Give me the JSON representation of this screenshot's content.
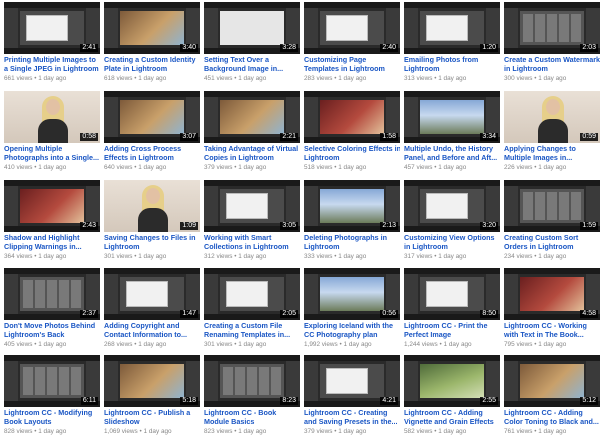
{
  "videos": [
    {
      "title1": "Printing Multiple Images to",
      "title2": "a Single JPEG in Lightroom",
      "meta": "661 views • 1 day ago",
      "duration": "2:41",
      "thumb": "dialog"
    },
    {
      "title1": "Creating a Custom Identity",
      "title2": "Plate in Lightroom",
      "meta": "618 views • 1 day ago",
      "duration": "3:40",
      "thumb": "photo"
    },
    {
      "title1": "Setting Text Over a",
      "title2": "Background Image in...",
      "meta": "451 views • 1 day ago",
      "duration": "3:28",
      "thumb": "light"
    },
    {
      "title1": "Customizing Page",
      "title2": "Templates in Lightroom",
      "meta": "283 views • 1 day ago",
      "duration": "2:40",
      "thumb": "dialog"
    },
    {
      "title1": "Emailing Photos from",
      "title2": "Lightroom",
      "meta": "313 views • 1 day ago",
      "duration": "1:20",
      "thumb": "dialog"
    },
    {
      "title1": "Create a Custom Watermark",
      "title2": "in Lightroom",
      "meta": "300 views • 1 day ago",
      "duration": "2:03",
      "thumb": "grid"
    },
    {
      "title1": "Opening Multiple",
      "title2": "Photographs into a Single...",
      "meta": "410 views • 1 day ago",
      "duration": "0:58",
      "thumb": "person"
    },
    {
      "title1": "Adding Cross Process",
      "title2": "Effects in Lightroom",
      "meta": "640 views • 1 day ago",
      "duration": "3:07",
      "thumb": "photo"
    },
    {
      "title1": "Taking Advantage of Virtual",
      "title2": "Copies in Lightroom",
      "meta": "379 views • 1 day ago",
      "duration": "2:21",
      "thumb": "photo"
    },
    {
      "title1": "Selective Coloring Effects in",
      "title2": "Lightroom",
      "meta": "518 views • 1 day ago",
      "duration": "1:58",
      "thumb": "photo red"
    },
    {
      "title1": "Multiple Undo, the History",
      "title2": "Panel, and Before and Aft...",
      "meta": "457 views • 1 day ago",
      "duration": "3:34",
      "thumb": "photo sky"
    },
    {
      "title1": "Applying Changes to",
      "title2": "Multiple Images in...",
      "meta": "226 views • 1 day ago",
      "duration": "0:59",
      "thumb": "person"
    },
    {
      "title1": "Shadow and Highlight",
      "title2": "Clipping Warnings in...",
      "meta": "364 views • 1 day ago",
      "duration": "2:43",
      "thumb": "photo red"
    },
    {
      "title1": "Saving Changes to Files in",
      "title2": "Lightroom",
      "meta": "301 views • 1 day ago",
      "duration": "1:09",
      "thumb": "person"
    },
    {
      "title1": "Working with Smart",
      "title2": "Collections in Lightroom",
      "meta": "312 views • 1 day ago",
      "duration": "3:05",
      "thumb": "dialog"
    },
    {
      "title1": "Deleting Photographs in",
      "title2": "Lightroom",
      "meta": "333 views • 1 day ago",
      "duration": "2:13",
      "thumb": "photo sky"
    },
    {
      "title1": "Customizing View Options",
      "title2": "in Lightroom",
      "meta": "317 views • 1 day ago",
      "duration": "3:20",
      "thumb": "dialog"
    },
    {
      "title1": "Creating Custom Sort",
      "title2": "Orders in Lightroom",
      "meta": "234 views • 1 day ago",
      "duration": "1:59",
      "thumb": "grid"
    },
    {
      "title1": "Don't Move Photos Behind",
      "title2": "Lightroom's Back",
      "meta": "405 views • 1 day ago",
      "duration": "2:37",
      "thumb": "grid"
    },
    {
      "title1": "Adding Copyright and",
      "title2": "Contact Information to...",
      "meta": "268 views • 1 day ago",
      "duration": "1:47",
      "thumb": "dialog"
    },
    {
      "title1": "Creating a Custom File",
      "title2": "Renaming Templates in...",
      "meta": "301 views • 1 day ago",
      "duration": "2:05",
      "thumb": "dialog"
    },
    {
      "title1": "Exploring Iceland with the",
      "title2": "CC Photography plan",
      "meta": "1,992 views • 1 day ago",
      "duration": "0:56",
      "thumb": "photo sky"
    },
    {
      "title1": "Lightroom CC - Print the",
      "title2": "Perfect Image",
      "meta": "1,244 views • 1 day ago",
      "duration": "8:50",
      "thumb": "dialog"
    },
    {
      "title1": "Lightroom CC - Working",
      "title2": "with Text in The Book...",
      "meta": "795 views • 1 day ago",
      "duration": "4:58",
      "thumb": "photo red"
    },
    {
      "title1": "Lightroom CC - Modifying",
      "title2": "Book Layouts",
      "meta": "828 views • 1 day ago",
      "duration": "6:11",
      "thumb": "grid"
    },
    {
      "title1": "Lightroom CC - Publish a",
      "title2": "Slideshow",
      "meta": "1,069 views • 1 day ago",
      "duration": "5:18",
      "thumb": "photo"
    },
    {
      "title1": "Lightroom CC - Book",
      "title2": "Module Basics",
      "meta": "823 views • 1 day ago",
      "duration": "8:23",
      "thumb": "grid"
    },
    {
      "title1": "Lightroom CC - Creating",
      "title2": "and Saving Presets in the...",
      "meta": "379 views • 1 day ago",
      "duration": "4:21",
      "thumb": "dialog"
    },
    {
      "title1": "Lightroom CC - Adding",
      "title2": "Vignette and Grain Effects",
      "meta": "582 views • 1 day ago",
      "duration": "2:55",
      "thumb": "photo green"
    },
    {
      "title1": "Lightroom CC - Adding",
      "title2": "Color Toning to Black and...",
      "meta": "761 views • 1 day ago",
      "duration": "5:12",
      "thumb": "photo"
    }
  ]
}
